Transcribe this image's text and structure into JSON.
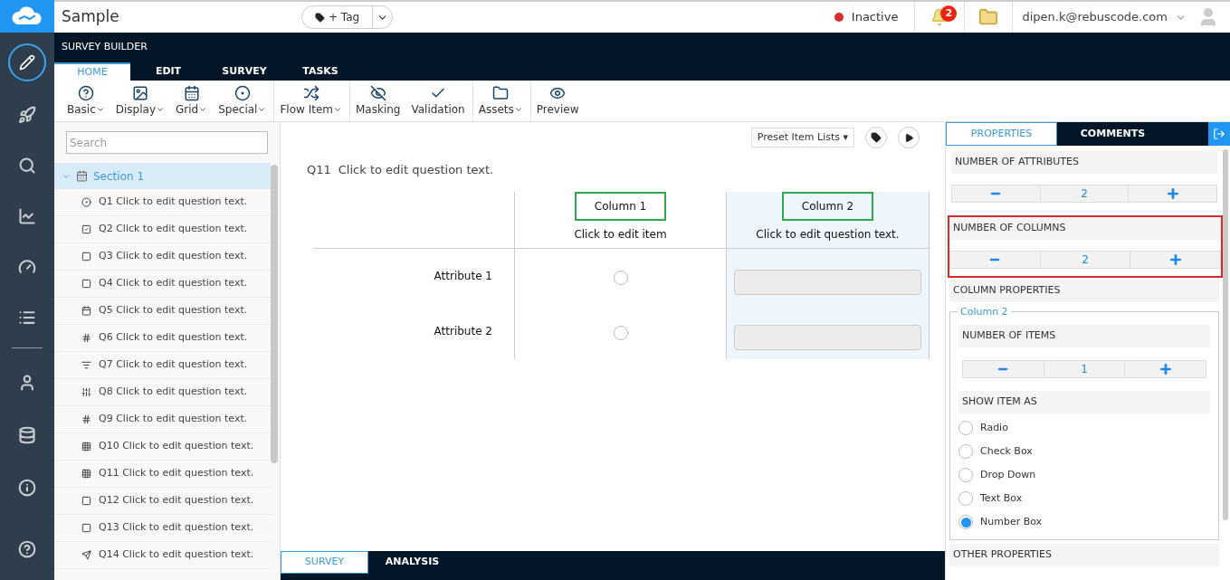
{
  "topbar": {
    "title": "Sample",
    "tag_button": "+ Tag",
    "status": {
      "label": "Inactive",
      "color": "#d32f2f"
    },
    "notifications": "2",
    "user": "dipen.k@rebuscode.com"
  },
  "builder": {
    "title": "SURVEY BUILDER",
    "tabs": [
      {
        "label": "HOME",
        "selected": true
      },
      {
        "label": "EDIT",
        "selected": false
      },
      {
        "label": "SURVEY",
        "selected": false
      },
      {
        "label": "TASKS",
        "selected": false
      }
    ]
  },
  "toolbar": [
    {
      "label": "Basic",
      "dropdown": true,
      "group_end": false
    },
    {
      "label": "Display",
      "dropdown": true,
      "group_end": false
    },
    {
      "label": "Grid",
      "dropdown": true,
      "group_end": false
    },
    {
      "label": "Special",
      "dropdown": true,
      "group_end": true
    },
    {
      "label": "Flow Item",
      "dropdown": true,
      "group_end": true
    },
    {
      "label": "Masking",
      "dropdown": false,
      "group_end": false
    },
    {
      "label": "Validation",
      "dropdown": false,
      "group_end": true
    },
    {
      "label": "Assets",
      "dropdown": true,
      "group_end": true
    },
    {
      "label": "Preview",
      "dropdown": false,
      "group_end": false
    }
  ],
  "tree": {
    "search_placeholder": "Search",
    "section": {
      "label": "Section 1",
      "expanded": true,
      "selected": true,
      "children": [
        {
          "label": "Q1 Click to edit question text."
        },
        {
          "label": "Q2 Click to edit question text."
        },
        {
          "label": "Q3 Click to edit question text."
        },
        {
          "label": "Q4 Click to edit question text."
        },
        {
          "label": "Q5 Click to edit question text."
        },
        {
          "label": "Q6 Click to edit question text."
        },
        {
          "label": "Q7 Click to edit question text."
        },
        {
          "label": "Q8 Click to edit question text."
        },
        {
          "label": "Q9 Click to edit question text."
        },
        {
          "label": "Q10 Click to edit question text."
        },
        {
          "label": "Q11 Click to edit question text."
        },
        {
          "label": "Q12 Click to edit question text."
        },
        {
          "label": "Q13 Click to edit question text."
        },
        {
          "label": "Q14 Click to edit question text."
        }
      ]
    }
  },
  "canvas": {
    "preset_button": "Preset Item Lists ▾",
    "question_number": "Q11",
    "question_text": "Click to edit question text.",
    "columns": [
      {
        "label": "Column 1",
        "item": "Click to edit item",
        "highlighted": true,
        "selected": false,
        "kind": "radio"
      },
      {
        "label": "Column 2",
        "item": "Click to edit question text.",
        "highlighted": true,
        "selected": true,
        "kind": "number"
      }
    ],
    "rows": [
      "Attribute 1",
      "Attribute 2"
    ],
    "bottom_tabs": [
      {
        "label": "SURVEY",
        "selected": true
      },
      {
        "label": "ANALYSIS",
        "selected": false
      }
    ]
  },
  "properties": {
    "tabs": [
      {
        "label": "PROPERTIES",
        "selected": true
      },
      {
        "label": "COMMENTS",
        "selected": false
      }
    ],
    "attributes": {
      "title": "NUMBER OF ATTRIBUTES",
      "value": "2",
      "highlighted": false
    },
    "columns": {
      "title": "NUMBER OF COLUMNS",
      "value": "2",
      "highlighted": true
    },
    "column_properties": {
      "title": "COLUMN PROPERTIES",
      "legend": "Column 2",
      "items_title": "NUMBER OF ITEMS",
      "items_value": "1",
      "show_as_title": "SHOW ITEM AS",
      "options": [
        {
          "label": "Radio",
          "selected": false
        },
        {
          "label": "Check Box",
          "selected": false
        },
        {
          "label": "Drop Down",
          "selected": false
        },
        {
          "label": "Text Box",
          "selected": false
        },
        {
          "label": "Number Box",
          "selected": true
        }
      ]
    },
    "other_title": "OTHER PROPERTIES"
  }
}
